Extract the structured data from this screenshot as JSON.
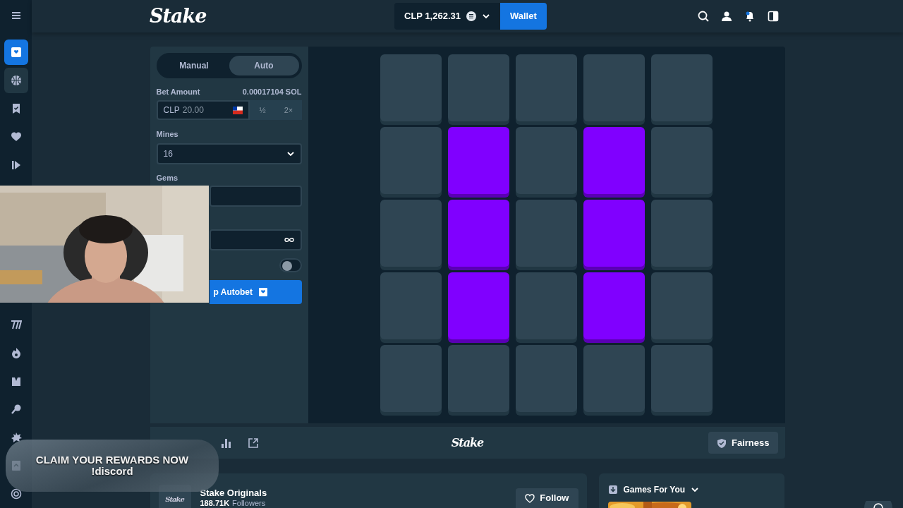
{
  "sidebar": {
    "items": [
      {
        "selected": true,
        "hovered": false
      },
      {
        "selected": false,
        "hovered": true
      },
      {
        "selected": false,
        "hovered": false
      },
      {
        "selected": false,
        "hovered": false
      },
      {
        "selected": false,
        "hovered": false
      }
    ],
    "lower_items": [
      {
        "selected": false
      },
      {
        "selected": false
      },
      {
        "selected": false
      },
      {
        "selected": false
      },
      {
        "selected": false
      },
      {
        "selected": false
      },
      {
        "selected": false
      }
    ]
  },
  "header": {
    "logo": "Stake",
    "balance": "CLP 1,262.31",
    "wallet_button": "Wallet"
  },
  "bet_panel": {
    "tabs": [
      {
        "label": "Manual",
        "selected": false
      },
      {
        "label": "Auto",
        "selected": true
      }
    ],
    "bet_amount_label": "Bet Amount",
    "bet_amount_crypto": "0.00017104 SOL",
    "currency": "CLP",
    "bet_value": "20.00",
    "half_button": "½",
    "double_button": "2×",
    "mines_label": "Mines",
    "mines_value": "16",
    "gems_label": "Gems",
    "stop_on_profit": {
      "on": false
    },
    "autobet_button": "p Autobet"
  },
  "board": {
    "rows": [
      [
        {
          "revealed": false
        },
        {
          "revealed": false
        },
        {
          "revealed": false
        },
        {
          "revealed": false
        },
        {
          "revealed": false
        }
      ],
      [
        {
          "revealed": false
        },
        {
          "revealed": true
        },
        {
          "revealed": false
        },
        {
          "revealed": true
        },
        {
          "revealed": false
        }
      ],
      [
        {
          "revealed": false
        },
        {
          "revealed": true
        },
        {
          "revealed": false
        },
        {
          "revealed": true
        },
        {
          "revealed": false
        }
      ],
      [
        {
          "revealed": false
        },
        {
          "revealed": true
        },
        {
          "revealed": false
        },
        {
          "revealed": true
        },
        {
          "revealed": false
        }
      ],
      [
        {
          "revealed": false
        },
        {
          "revealed": false
        },
        {
          "revealed": false
        },
        {
          "revealed": false
        },
        {
          "revealed": false
        }
      ]
    ]
  },
  "footer_bar": {
    "logo": "Stake",
    "fairness_button": "Fairness"
  },
  "originals_card": {
    "logo": "Stake",
    "title": "Stake Originals",
    "followers": "188.71K",
    "followers_label": "Followers",
    "follow_button": "Follow"
  },
  "games_card": {
    "title": "Games For You"
  },
  "overlay": {
    "line_1": "CLAIM YOUR REWARDS NOW",
    "line_2": "!discord"
  }
}
